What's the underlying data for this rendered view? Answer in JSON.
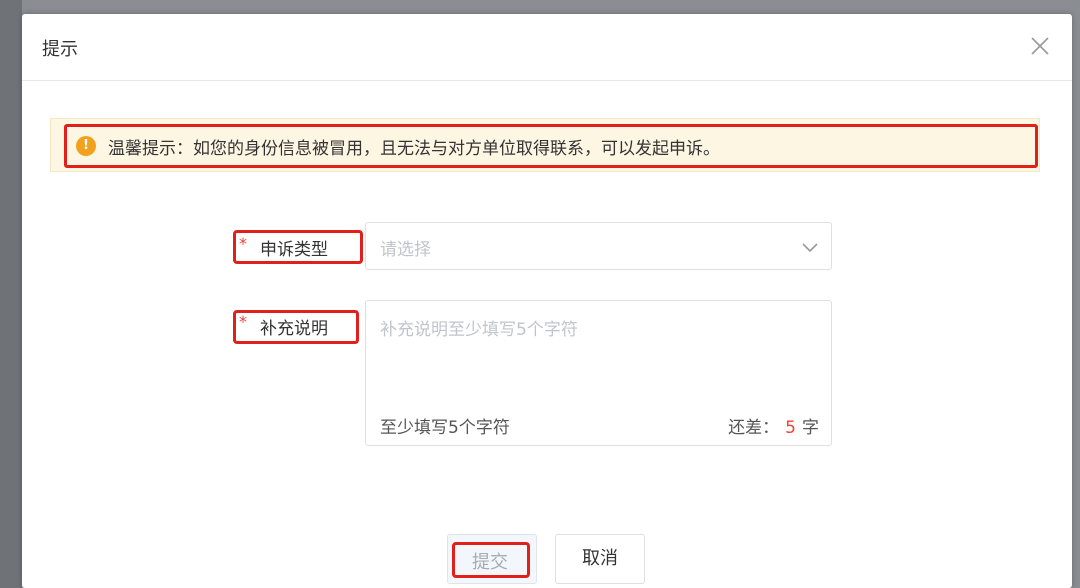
{
  "dialog": {
    "title": "提示",
    "close_icon": "close-icon"
  },
  "tip": {
    "icon": "warning-circle-icon",
    "icon_glyph": "!",
    "text": "温馨提示：如您的身份信息被冒用，且无法与对方单位取得联系，可以发起申诉。"
  },
  "form": {
    "appeal_type": {
      "required_mark": "*",
      "label": "申诉类型",
      "placeholder": "请选择",
      "icon": "chevron-down-icon"
    },
    "description": {
      "required_mark": "*",
      "label": "补充说明",
      "placeholder": "补充说明至少填写5个字符",
      "hint": "至少填写5个字符",
      "remain_prefix": "还差：",
      "remain_count": "5",
      "remain_suffix": "字"
    }
  },
  "actions": {
    "submit_label": "提交",
    "cancel_label": "取消"
  },
  "colors": {
    "highlight": "#e0201b",
    "tip_background": "#fdf6e3",
    "tip_icon": "#f2a11f",
    "required": "#f04134"
  }
}
